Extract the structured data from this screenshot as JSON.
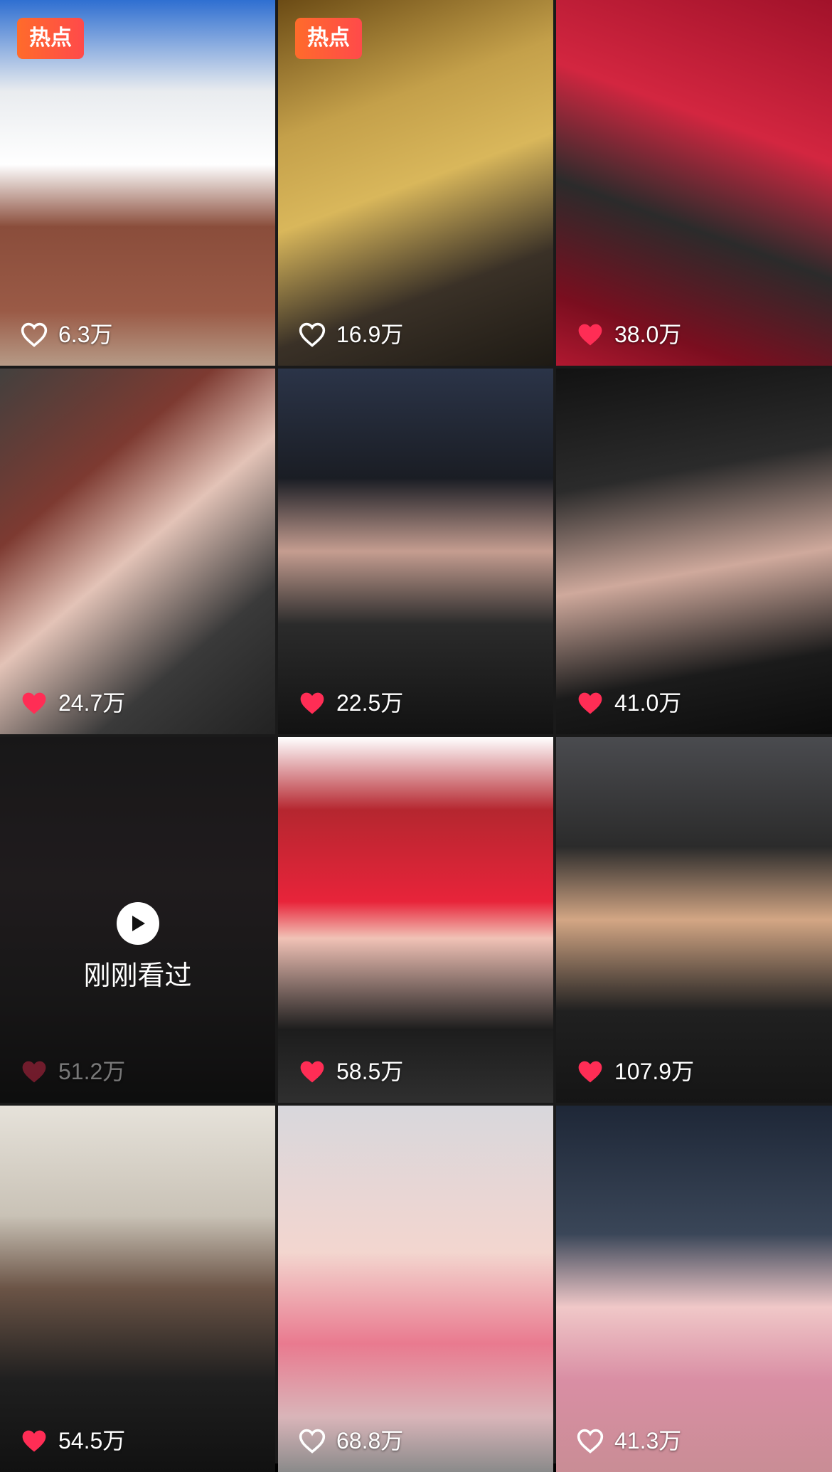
{
  "badges": {
    "hot": "热点"
  },
  "watched": {
    "label": "刚刚看过"
  },
  "colors": {
    "liked_heart": "#ff2d55",
    "outline_heart": "#ffffff",
    "hot_badge": "#ff5a36"
  },
  "videos": [
    {
      "likes": "6.3万",
      "liked": false,
      "hot": true
    },
    {
      "likes": "16.9万",
      "liked": false,
      "hot": true
    },
    {
      "likes": "38.0万",
      "liked": true,
      "hot": false
    },
    {
      "likes": "24.7万",
      "liked": true,
      "hot": false
    },
    {
      "likes": "22.5万",
      "liked": true,
      "hot": false
    },
    {
      "likes": "41.0万",
      "liked": true,
      "hot": false
    },
    {
      "likes": "51.2万",
      "liked": true,
      "hot": false,
      "watched": true
    },
    {
      "likes": "58.5万",
      "liked": true,
      "hot": false
    },
    {
      "likes": "107.9万",
      "liked": true,
      "hot": false
    },
    {
      "likes": "54.5万",
      "liked": true,
      "hot": false
    },
    {
      "likes": "68.8万",
      "liked": false,
      "hot": false
    },
    {
      "likes": "41.3万",
      "liked": false,
      "hot": false
    }
  ]
}
